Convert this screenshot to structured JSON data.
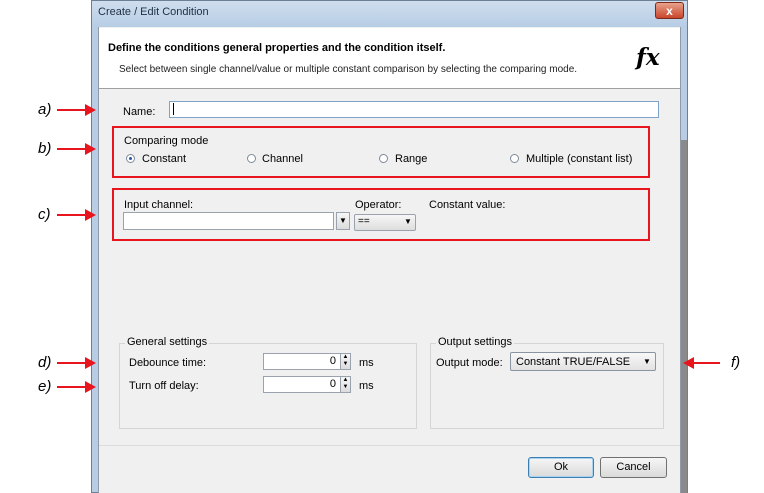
{
  "window": {
    "title": "Create / Edit Condition",
    "close_glyph": "x"
  },
  "header": {
    "title": "Define the conditions general properties and the condition itself.",
    "subtitle": "Select between single channel/value or multiple constant comparison by selecting the comparing mode.",
    "icon": "function-fx-icon",
    "icon_text": "fx"
  },
  "name": {
    "label": "Name:",
    "value": ""
  },
  "comparing_mode": {
    "label": "Comparing mode",
    "options": [
      "Constant",
      "Channel",
      "Range",
      "Multiple (constant list)"
    ],
    "selected": "Constant"
  },
  "input": {
    "channel_label": "Input channel:",
    "channel_value": "",
    "operator_label": "Operator:",
    "operator_value": "==",
    "constant_label": "Constant value:"
  },
  "general_settings": {
    "label": "General settings",
    "debounce_label": "Debounce time:",
    "debounce_value": "0",
    "debounce_unit": "ms",
    "turnoff_label": "Turn off delay:",
    "turnoff_value": "0",
    "turnoff_unit": "ms"
  },
  "output_settings": {
    "label": "Output settings",
    "mode_label": "Output mode:",
    "mode_value": "Constant TRUE/FALSE"
  },
  "buttons": {
    "ok": "Ok",
    "cancel": "Cancel"
  },
  "annotations": [
    "a)",
    "b)",
    "c)",
    "d)",
    "e)",
    "f)"
  ],
  "colors": {
    "highlight": "#e8151e",
    "titlebar": "#b7cde4",
    "dialog_bg": "#f0f0f0"
  }
}
